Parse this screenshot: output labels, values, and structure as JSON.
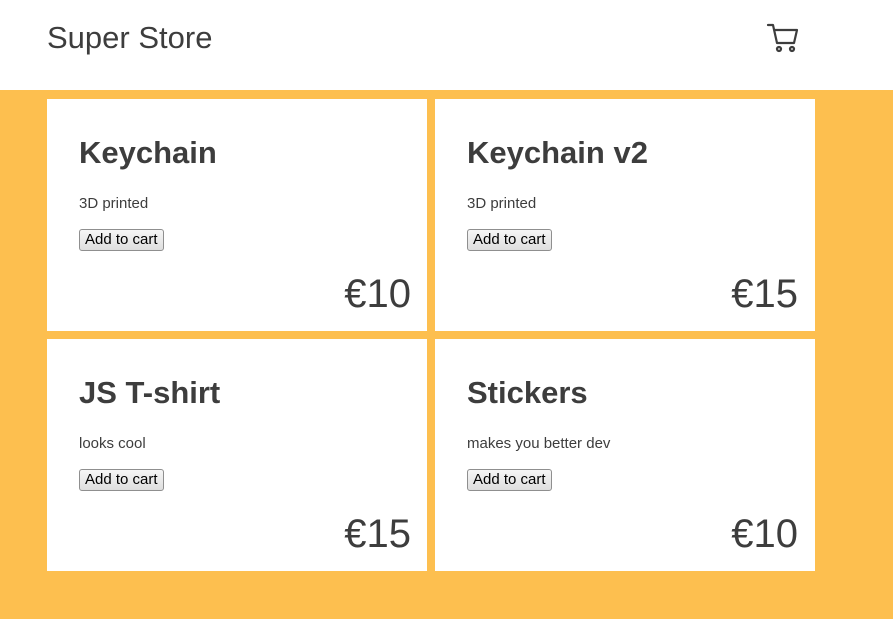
{
  "header": {
    "title": "Super Store",
    "cart_icon": "shopping-cart-icon"
  },
  "colors": {
    "background": "#fdbf4f",
    "card": "#ffffff",
    "text": "#3d3d3d"
  },
  "products": [
    {
      "name": "Keychain",
      "description": "3D printed",
      "button": "Add to cart",
      "price": "€10"
    },
    {
      "name": "Keychain v2",
      "description": "3D printed",
      "button": "Add to cart",
      "price": "€15"
    },
    {
      "name": "JS T-shirt",
      "description": "looks cool",
      "button": "Add to cart",
      "price": "€15"
    },
    {
      "name": "Stickers",
      "description": "makes you better dev",
      "button": "Add to cart",
      "price": "€10"
    }
  ]
}
